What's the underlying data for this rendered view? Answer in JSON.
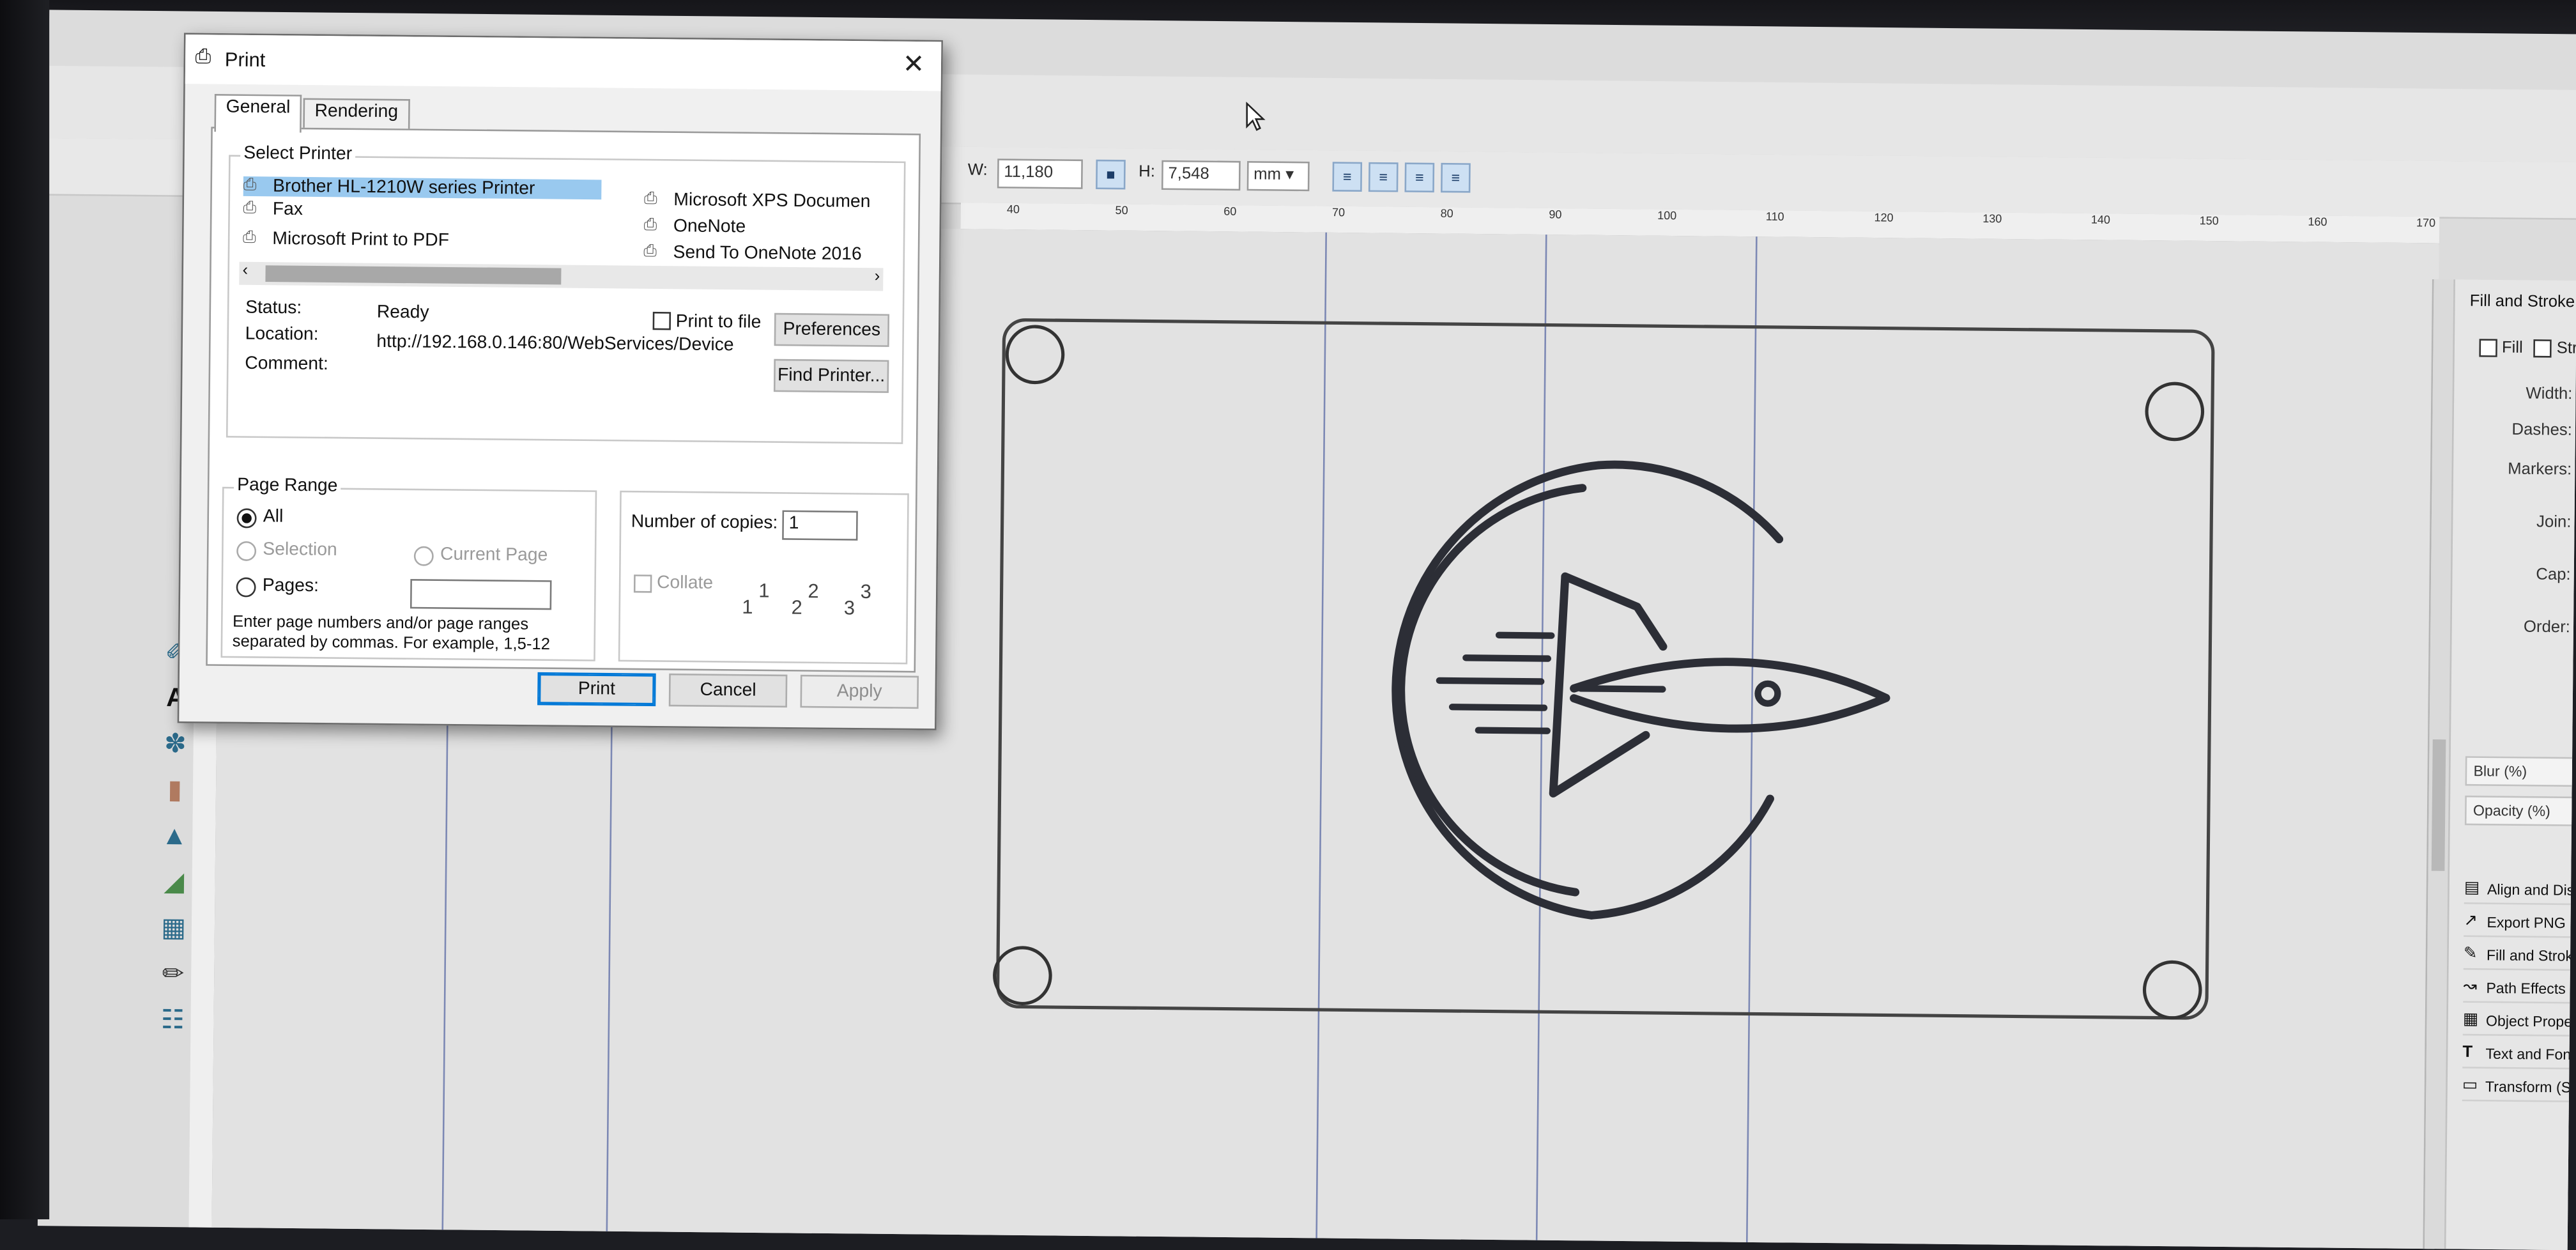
{
  "toolbar": {
    "w_label": "W:",
    "w_value": "11,180",
    "h_label": "H:",
    "h_value": "7,548",
    "unit": "mm"
  },
  "ruler_ticks": [
    "40",
    "50",
    "60",
    "70",
    "80",
    "90",
    "100",
    "110",
    "120",
    "130",
    "140",
    "150",
    "160",
    "170"
  ],
  "dock": {
    "title": "Fill and Stroke (Sh",
    "fill_tab": "Fill",
    "stroke_tab": "Stroke pa",
    "props": [
      "Width:",
      "Dashes:",
      "Markers:",
      "Join:",
      "Cap:",
      "Order:"
    ],
    "blur": "Blur (%)",
    "opacity": "Opacity (%)",
    "panels": [
      {
        "label": "Align and Distrib",
        "icon": "align-icon"
      },
      {
        "label": "Export PNG Imag",
        "icon": "export-icon"
      },
      {
        "label": "Fill and Stroke (S",
        "icon": "fill-stroke-icon"
      },
      {
        "label": "Path Effects  (Shi",
        "icon": "path-effects-icon"
      },
      {
        "label": "Object Propertie",
        "icon": "object-properties-icon"
      },
      {
        "label": "Text and Font (Sh",
        "icon": "text-font-icon"
      },
      {
        "label": "Transform (Shift-",
        "icon": "transform-icon"
      }
    ]
  },
  "tools": [
    "pen-icon",
    "text-tool-icon",
    "spray-icon",
    "eraser-icon",
    "bucket-icon",
    "gradient-icon",
    "mesh-icon",
    "dropper-icon",
    "connector-icon"
  ],
  "dialog": {
    "title": "Print",
    "tabs": [
      "General",
      "Rendering"
    ],
    "select_printer": "Select Printer",
    "printers_left": [
      "Brother HL-1210W series Printer",
      "Fax",
      "Microsoft Print to PDF"
    ],
    "printers_right": [
      "Microsoft XPS Documen",
      "OneNote",
      "Send To OneNote 2016"
    ],
    "status_label": "Status:",
    "status_value": "Ready",
    "location_label": "Location:",
    "location_value": "http://192.168.0.146:80/WebServices/Device",
    "comment_label": "Comment:",
    "print_to_file": "Print to file",
    "preferences": "Preferences",
    "find_printer": "Find Printer...",
    "page_range": "Page Range",
    "all": "All",
    "selection": "Selection",
    "current_page": "Current Page",
    "pages": "Pages:",
    "pages_hint_1": "Enter page numbers and/or page ranges",
    "pages_hint_2": "separated by commas.  For example, 1,5-12",
    "copies_label": "Number of copies:",
    "copies_value": "1",
    "collate": "Collate",
    "collate_pages": [
      "1",
      "1",
      "2",
      "2",
      "3",
      "3"
    ],
    "print": "Print",
    "cancel": "Cancel",
    "apply": "Apply"
  }
}
